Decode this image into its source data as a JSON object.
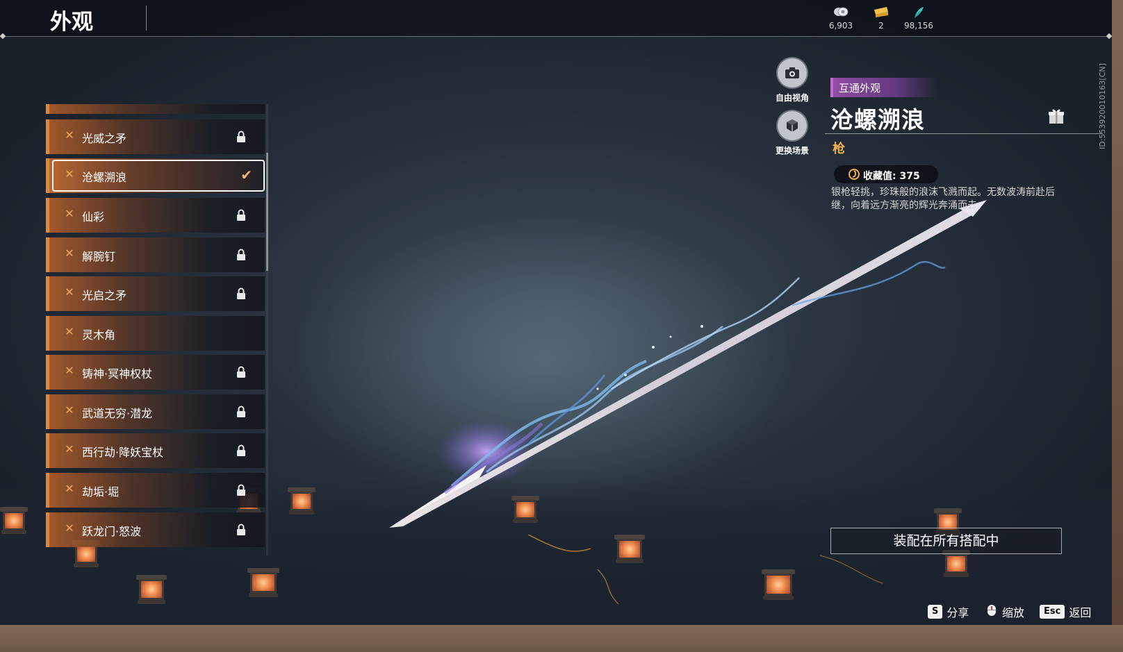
{
  "header": {
    "title": "外观",
    "currencies": [
      {
        "icon": "coin-icon",
        "value": "6,903"
      },
      {
        "icon": "ticket-icon",
        "value": "2"
      },
      {
        "icon": "feather-icon",
        "value": "98,156"
      }
    ]
  },
  "side_id": "ID:553920010163[CN]",
  "list": {
    "items": [
      {
        "name": "光威之矛",
        "locked": true
      },
      {
        "name": "沧螺溯浪",
        "locked": false,
        "selected": true
      },
      {
        "name": "仙彩",
        "locked": true
      },
      {
        "name": "解腕钉",
        "locked": true
      },
      {
        "name": "光启之矛",
        "locked": true
      },
      {
        "name": "灵木角",
        "locked": false
      },
      {
        "name": "铸神·冥神权杖",
        "locked": true
      },
      {
        "name": "武道无穷·潜龙",
        "locked": true
      },
      {
        "name": "西行劫·降妖宝杖",
        "locked": true
      },
      {
        "name": "劫垢·堀",
        "locked": true
      },
      {
        "name": "跃龙门·怒波",
        "locked": true
      }
    ]
  },
  "camera": {
    "free_view": "自由视角",
    "change_scene": "更换场景"
  },
  "detail": {
    "tag": "互通外观",
    "title": "沧螺溯浪",
    "type": "枪",
    "collect_label": "收藏值: 375",
    "description": "银枪轻挑，珍珠般的浪沫飞溅而起。无数波涛前赴后继，向着远方渐亮的辉光奔涌而去。",
    "equip_button": "装配在所有搭配中"
  },
  "hints": [
    {
      "key": "S",
      "label": "分享"
    },
    {
      "key": "",
      "label": "缩放"
    },
    {
      "key": "Esc",
      "label": "返回"
    }
  ],
  "colors": {
    "accent_orange": "#d88a40",
    "tag_purple": "#9a4fb0",
    "type_gold": "#f0b04e"
  }
}
